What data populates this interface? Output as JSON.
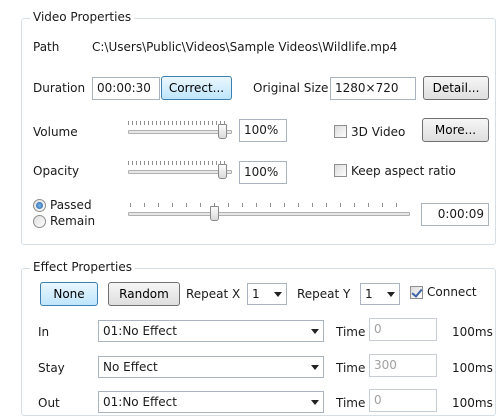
{
  "video_properties": {
    "group_title": "Video Properties",
    "path_label": "Path",
    "path_value": "C:\\Users\\Public\\Videos\\Sample Videos\\Wildlife.mp4",
    "duration_label": "Duration",
    "duration_value": "00:00:30",
    "correct_button": "Correct...",
    "original_size_label": "Original Size",
    "original_size_value": "1280×720",
    "detail_button": "Detail...",
    "volume_label": "Volume",
    "volume_value": "100%",
    "volume_level": 1.0,
    "three_d_label": "3D Video",
    "three_d_checked": false,
    "more_button": "More...",
    "opacity_label": "Opacity",
    "opacity_value": "100%",
    "opacity_level": 1.0,
    "keep_aspect_label": "Keep aspect ratio",
    "keep_aspect_checked": false,
    "passed_label": "Passed",
    "remain_label": "Remain",
    "selected_time_mode": "Passed",
    "position_value": "0:00:09",
    "position_fraction": 0.3
  },
  "effect_properties": {
    "group_title": "Effect Properties",
    "none_button": "None",
    "random_button": "Random",
    "repeat_x_label": "Repeat X",
    "repeat_x_value": "1",
    "repeat_y_label": "Repeat Y",
    "repeat_y_value": "1",
    "connect_label": "Connect",
    "connect_checked": true,
    "rows": [
      {
        "label": "In",
        "effect": "01:No Effect",
        "time_label": "Time",
        "time_value": "0",
        "unit": "100ms"
      },
      {
        "label": "Stay",
        "effect": "No Effect",
        "time_label": "Time",
        "time_value": "300",
        "unit": "100ms"
      },
      {
        "label": "Out",
        "effect": "01:No Effect",
        "time_label": "Time",
        "time_value": "0",
        "unit": "100ms"
      }
    ]
  }
}
